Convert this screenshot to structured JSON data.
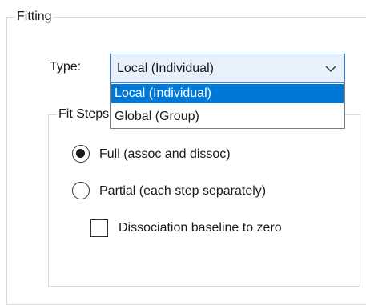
{
  "fitting": {
    "title": "Fitting",
    "type_label": "Type:",
    "type_value": "Local (Individual)",
    "type_options": [
      "Local (Individual)",
      "Global (Group)"
    ],
    "fit_steps": {
      "title": "Fit Steps",
      "full_label": "Full (assoc and dissoc)",
      "partial_label": "Partial (each step separately)",
      "full_selected": true,
      "baseline_label": "Dissociation baseline to zero",
      "baseline_checked": false
    }
  },
  "colors": {
    "accent": "#0078d7",
    "combo_border": "#2d7bd4",
    "combo_bg": "#e7f1fc"
  }
}
